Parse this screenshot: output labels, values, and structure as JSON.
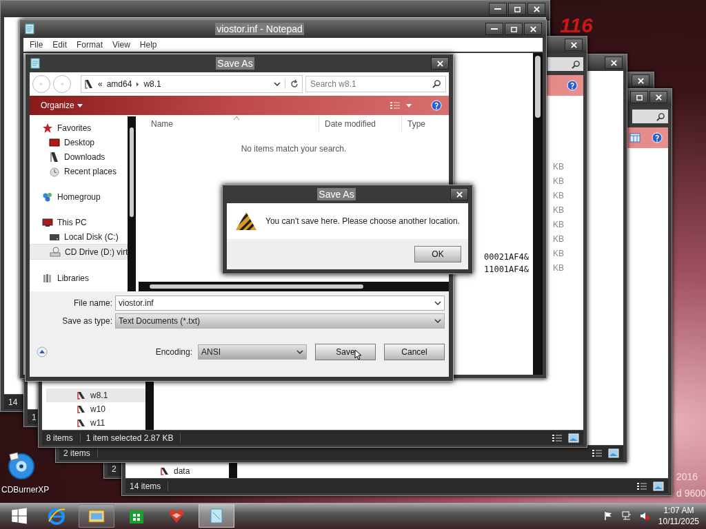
{
  "desktop": {
    "logo": "116",
    "wallpaper_texts": [
      "2016",
      "d 9600"
    ],
    "icons": [
      {
        "label": "CDBurnerXP"
      }
    ]
  },
  "background_windows": [
    {
      "controls": [
        {
          "kind": "minimize"
        },
        {
          "kind": "maximize"
        },
        {
          "kind": "close"
        }
      ],
      "status": [
        "14"
      ]
    },
    {
      "status": [
        "1"
      ]
    },
    {
      "controls": [
        {
          "kind": "close"
        }
      ],
      "status": [
        "2"
      ]
    },
    {
      "controls": [
        {
          "kind": "maximize"
        },
        {
          "kind": "close"
        }
      ],
      "status": [
        "14 items"
      ],
      "search": true,
      "tools": [
        {
          "kind": "layout"
        },
        {
          "kind": "help"
        }
      ],
      "tree": [
        {
          "label": "data",
          "selected": false
        }
      ],
      "view_icons": true
    },
    {
      "controls": [
        {
          "kind": "close"
        }
      ],
      "status": [
        "2 items"
      ],
      "view_icons": true
    },
    {
      "controls": [
        {
          "kind": "close"
        }
      ],
      "status": [
        "8 items",
        "1 item selected 2.87 KB"
      ],
      "search": true,
      "tools": [
        {
          "kind": "help"
        }
      ],
      "tree": [
        {
          "label": "w8.1",
          "selected": true
        },
        {
          "label": "w10",
          "selected": false
        },
        {
          "label": "w11",
          "selected": false
        }
      ],
      "sizes": [
        "KB",
        "KB",
        "KB",
        "KB",
        "KB",
        "KB",
        "KB",
        "KB"
      ],
      "view_icons": true
    }
  ],
  "notepad": {
    "title": "viostor.inf - Notepad",
    "controls": [
      {
        "kind": "minimize"
      },
      {
        "kind": "maximize"
      },
      {
        "kind": "close"
      }
    ],
    "menu": [
      "File",
      "Edit",
      "Format",
      "View",
      "Help"
    ],
    "lines": [
      "00021AF4&",
      "11001AF4&"
    ]
  },
  "save_dialog": {
    "title": "Save As",
    "path_prefix": "«",
    "path": [
      "amd64",
      "w8.1"
    ],
    "search_placeholder": "Search w8.1",
    "organize": "Organize",
    "nav": [
      {
        "label": "Favorites",
        "kind": "star",
        "selected": false,
        "children": [
          {
            "label": "Desktop",
            "kind": "desktop",
            "selected": false
          },
          {
            "label": "Downloads",
            "kind": "downloads",
            "selected": false
          },
          {
            "label": "Recent places",
            "kind": "recent",
            "selected": false
          }
        ]
      },
      {
        "label": "Homegroup",
        "kind": "homegroup",
        "selected": false
      },
      {
        "label": "This PC",
        "kind": "pc",
        "selected": false,
        "children": [
          {
            "label": "Local Disk (C:)",
            "kind": "disk",
            "selected": false
          },
          {
            "label": "CD Drive (D:) virt",
            "kind": "cd",
            "selected": true
          }
        ]
      },
      {
        "label": "Libraries",
        "kind": "libraries",
        "selected": false
      }
    ],
    "columns": [
      "Name",
      "Date modified",
      "Type"
    ],
    "empty_message": "No items match your search.",
    "fields": [
      {
        "label": "File name:",
        "value": "viostor.inf"
      },
      {
        "label": "Save as type:",
        "value": "Text Documents (*.txt)"
      }
    ],
    "encoding": {
      "label": "Encoding:",
      "value": "ANSI"
    },
    "buttons": [
      "Save",
      "Cancel"
    ]
  },
  "message_box": {
    "title": "Save As",
    "text": "You can't save here. Please choose another location.",
    "button": "OK"
  },
  "taskbar": {
    "apps": [
      {
        "kind": "ie",
        "running": false,
        "selected": false
      },
      {
        "kind": "explorer",
        "running": true,
        "selected": false
      },
      {
        "kind": "store",
        "running": false,
        "selected": false
      },
      {
        "kind": "app",
        "running": false,
        "selected": false
      },
      {
        "kind": "notepad",
        "running": true,
        "selected": true
      }
    ],
    "clock": {
      "time": "1:07 AM",
      "date": "10/11/2025"
    }
  }
}
